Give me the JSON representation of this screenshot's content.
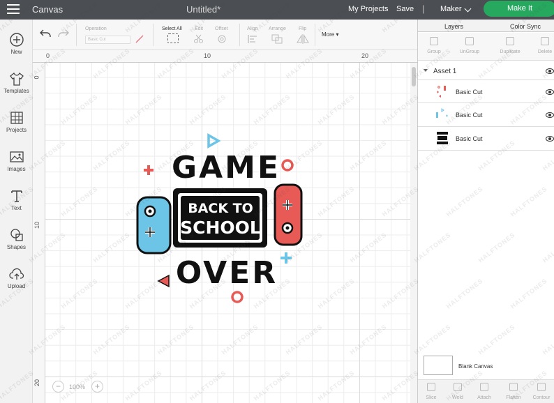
{
  "topbar": {
    "app_title": "Canvas",
    "doc_title": "Untitled*",
    "my_projects": "My Projects",
    "save": "Save",
    "separator": "|",
    "machine": "Maker",
    "make_it": "Make It"
  },
  "leftbar": {
    "items": [
      {
        "label": "New",
        "icon": "plus-circle-icon"
      },
      {
        "label": "Templates",
        "icon": "tshirt-icon"
      },
      {
        "label": "Projects",
        "icon": "projects-grid-icon"
      },
      {
        "label": "Images",
        "icon": "image-icon"
      },
      {
        "label": "Text",
        "icon": "text-t-icon"
      },
      {
        "label": "Shapes",
        "icon": "shapes-icon"
      },
      {
        "label": "Upload",
        "icon": "cloud-upload-icon"
      }
    ]
  },
  "toolbar": {
    "operation_label": "Operation",
    "operation_value": "Basic Cut",
    "select_all": "Select All",
    "edit": "Edit",
    "offset": "Offset",
    "align": "Align",
    "arrange": "Arrange",
    "flip": "Flip",
    "more": "More"
  },
  "rulers": {
    "top": [
      "0",
      "10",
      "20"
    ],
    "left": [
      "0",
      "10",
      "20"
    ]
  },
  "zoom": {
    "minus": "−",
    "value": "100%",
    "plus": "+"
  },
  "design": {
    "word_top": "GAME",
    "box_line1": "BACK TO",
    "box_line2": "SCHOOL",
    "word_bottom": "OVER",
    "colors": {
      "black": "#111111",
      "red": "#e85a55",
      "blue": "#6cc4e6"
    }
  },
  "panel": {
    "tabs": [
      "Layers",
      "Color Sync"
    ],
    "tools": [
      "Group",
      "UnGroup",
      "Duplicate",
      "Delete"
    ],
    "asset": "Asset 1",
    "layers": [
      {
        "name": "Basic Cut",
        "thumb": "red-pieces"
      },
      {
        "name": "Basic Cut",
        "thumb": "blue-pieces"
      },
      {
        "name": "Basic Cut",
        "thumb": "black-text"
      }
    ],
    "blank_canvas": "Blank Canvas",
    "bottom_tools": [
      "Slice",
      "Weld",
      "Attach",
      "Flatten",
      "Contour"
    ]
  },
  "watermark": "HALFTONES",
  "accent": "#27a85f"
}
